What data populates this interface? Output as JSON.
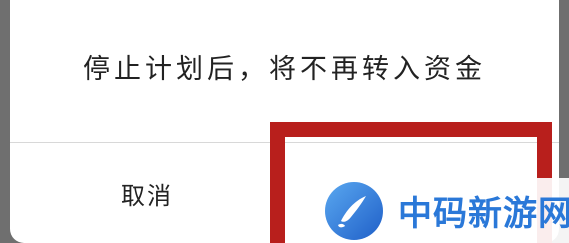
{
  "dialog": {
    "message": "停止计划后，将不再转入资金",
    "cancel_label": "取消"
  },
  "watermark": {
    "brand_text": "中码新游网",
    "logo_icon": "brush-circle-logo-icon"
  },
  "colors": {
    "highlight_border": "#b81f1c",
    "brand_blue": "#2a78d8",
    "confirm_accent": "#3e9a4f",
    "backdrop": "#6f6f6f"
  }
}
